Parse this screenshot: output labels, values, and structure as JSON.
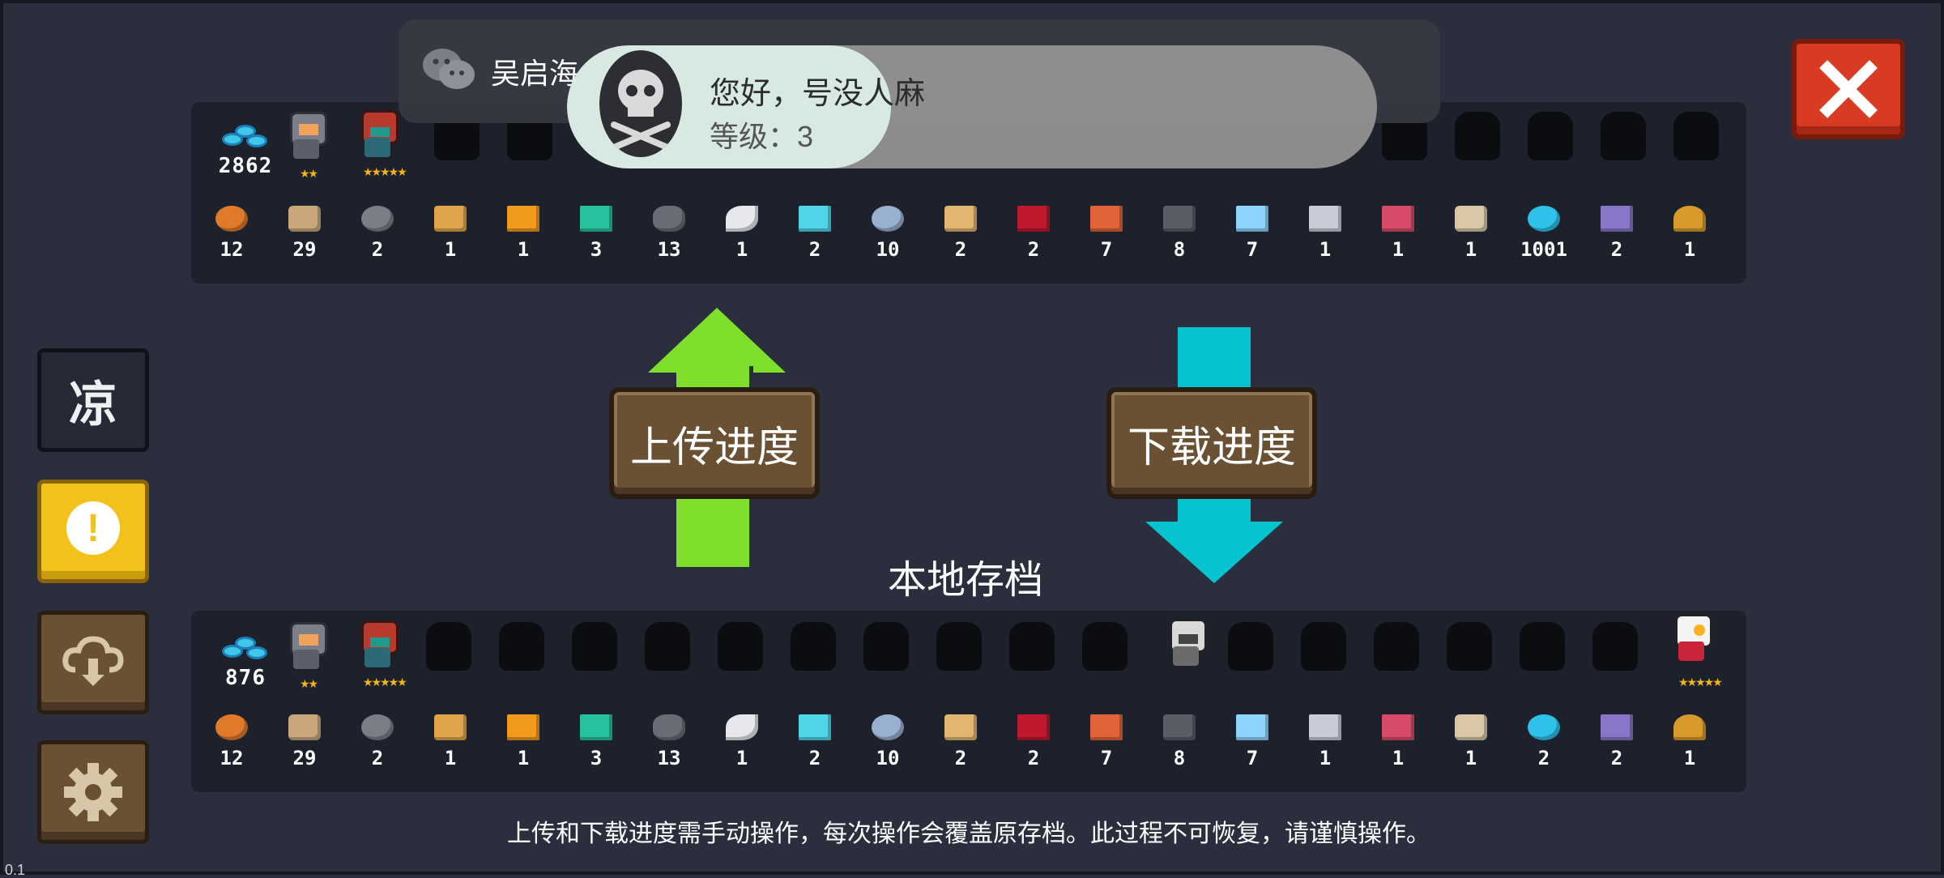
{
  "notification": {
    "app": "wechat",
    "icon": "wechat-icon",
    "text": "吴启海  不不不  什么版都没有"
  },
  "account_toast": {
    "name": "您好，号没人麻",
    "level": "等级：3",
    "avatar_icon": "skull-crossbones-icon"
  },
  "cloud_save": {
    "currency_value": "2862",
    "materials": [
      "12",
      "29",
      "2",
      "1",
      "1",
      "3",
      "13",
      "1",
      "2",
      "10",
      "2",
      "2",
      "7",
      "8",
      "7",
      "1",
      "1",
      "1",
      "1001",
      "2",
      "1"
    ]
  },
  "local_save": {
    "label": "本地存档",
    "currency_value": "876",
    "materials": [
      "12",
      "29",
      "2",
      "1",
      "1",
      "3",
      "13",
      "1",
      "2",
      "10",
      "2",
      "2",
      "7",
      "8",
      "7",
      "1",
      "1",
      "1",
      "2",
      "2",
      "1"
    ]
  },
  "buttons": {
    "upload": "上传进度",
    "download": "下载进度",
    "side_logo": "凉"
  },
  "footer_note": "上传和下载进度需手动操作，每次操作会覆盖原存档。此过程不可恢复，请谨慎操作。",
  "version_text": "0.1",
  "colors": {
    "background": "#2b2f3d",
    "panel": "#1d212b",
    "upload_arrow": "#7fe02c",
    "download_arrow": "#07c2cf",
    "close_button": "#d83a22",
    "warning_button": "#f2c21a",
    "wood_button": "#6a5134"
  }
}
